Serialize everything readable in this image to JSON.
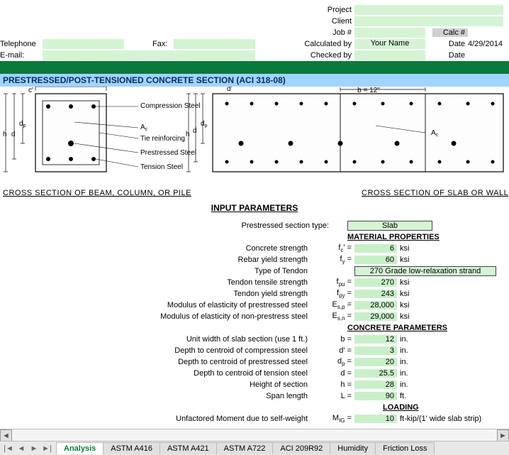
{
  "header": {
    "telephone_label": "Telephone",
    "fax_label": "Fax:",
    "email_label": "E-mail:",
    "project_label": "Project",
    "client_label": "Client",
    "job_label": "Job #",
    "calc_by_label": "Calculated by",
    "checked_by_label": "Checked by",
    "calc_num_label": "Calc #",
    "date_label": "Date",
    "your_name": "Your Name",
    "date_value": "4/29/2014"
  },
  "title_bar": "PRESTRESSED/POST-TENSIONED CONCRETE SECTION (ACI 318-08)",
  "diag": {
    "beam_caption": "CROSS SECTION OF BEAM, COLUMN, OR PILE",
    "slab_caption": "CROSS SECTION OF SLAB OR WALL",
    "b_eq_12": "b = 12\"",
    "c_prime": "c'",
    "d_prime": "d'",
    "d": "d",
    "dp": "d",
    "p_sub": "p",
    "h": "h",
    "Ac": "A",
    "c_sub": "c",
    "compression_steel": "Compression Steel",
    "tie_reinforcing": "Tie reinforcing",
    "prestressed_steel": "Prestressed Steel",
    "tension_steel": "Tension Steel"
  },
  "input_params_heading": "INPUT PARAMETERS",
  "section_type_label": "Prestressed section type:",
  "section_type_value": "Slab",
  "material_props_heading": "MATERIAL PROPERTIES",
  "concrete_params_heading": "CONCRETE PARAMETERS",
  "loading_heading": "LOADING",
  "rows": {
    "concrete_strength": {
      "label": "Concrete strength",
      "sym": "f",
      "sub": "c",
      "postsym": "' =",
      "val": "6",
      "unit": "ksi"
    },
    "rebar_yield": {
      "label": "Rebar yield strength",
      "sym": "f",
      "sub": "y",
      "postsym": " =",
      "val": "60",
      "unit": "ksi"
    },
    "tendon_type": {
      "label": "Type of Tendon",
      "val": "270 Grade low-relaxation strand"
    },
    "tendon_tensile": {
      "label": "Tendon tensile strength",
      "sym": "f",
      "sub": "pu",
      "postsym": " =",
      "val": "270",
      "unit": "ksi"
    },
    "tendon_yield": {
      "label": "Tendon yield strength",
      "sym": "f",
      "sub": "py",
      "postsym": " =",
      "val": "243",
      "unit": "ksi"
    },
    "e_prestress": {
      "label": "Modulus of elasticity of prestressed steel",
      "sym": "E",
      "sub": "s,p",
      "postsym": " =",
      "val": "28,000",
      "unit": "ksi"
    },
    "e_nonprestress": {
      "label": "Modulus of elasticity of non-prestress steel",
      "sym": "E",
      "sub": "s,n",
      "postsym": " =",
      "val": "29,000",
      "unit": "ksi"
    },
    "unit_width": {
      "label": "Unit width of slab section (use 1 ft.)",
      "sym": "b",
      "postsym": " =",
      "val": "12",
      "unit": "in."
    },
    "d_prime": {
      "label": "Depth to centroid of compression steel",
      "sym": "d'",
      "postsym": " =",
      "val": "3",
      "unit": "in."
    },
    "d_p": {
      "label": "Depth to centroid of prestressed steel",
      "sym": "d",
      "sub": "p",
      "postsym": " =",
      "val": "20",
      "unit": "in."
    },
    "d_tension": {
      "label": "Depth to centroid of tension steel",
      "sym": "d",
      "postsym": " =",
      "val": "25.5",
      "unit": "in."
    },
    "h": {
      "label": "Height of section",
      "sym": "h",
      "postsym": " =",
      "val": "28",
      "unit": "in."
    },
    "span": {
      "label": "Span length",
      "sym": "L",
      "postsym": " =",
      "val": "90",
      "unit": "ft."
    },
    "mig": {
      "label": "Unfactored Moment due to self-weight",
      "sym": "M",
      "sub": "IG",
      "postsym": " =",
      "val": "10",
      "unit": "ft-kip/(1' wide slab strip)"
    }
  },
  "tabs": [
    "Analysis",
    "ASTM A416",
    "ASTM A421",
    "ASTM A722",
    "ACI 209R92",
    "Humidity",
    "Friction Loss"
  ]
}
